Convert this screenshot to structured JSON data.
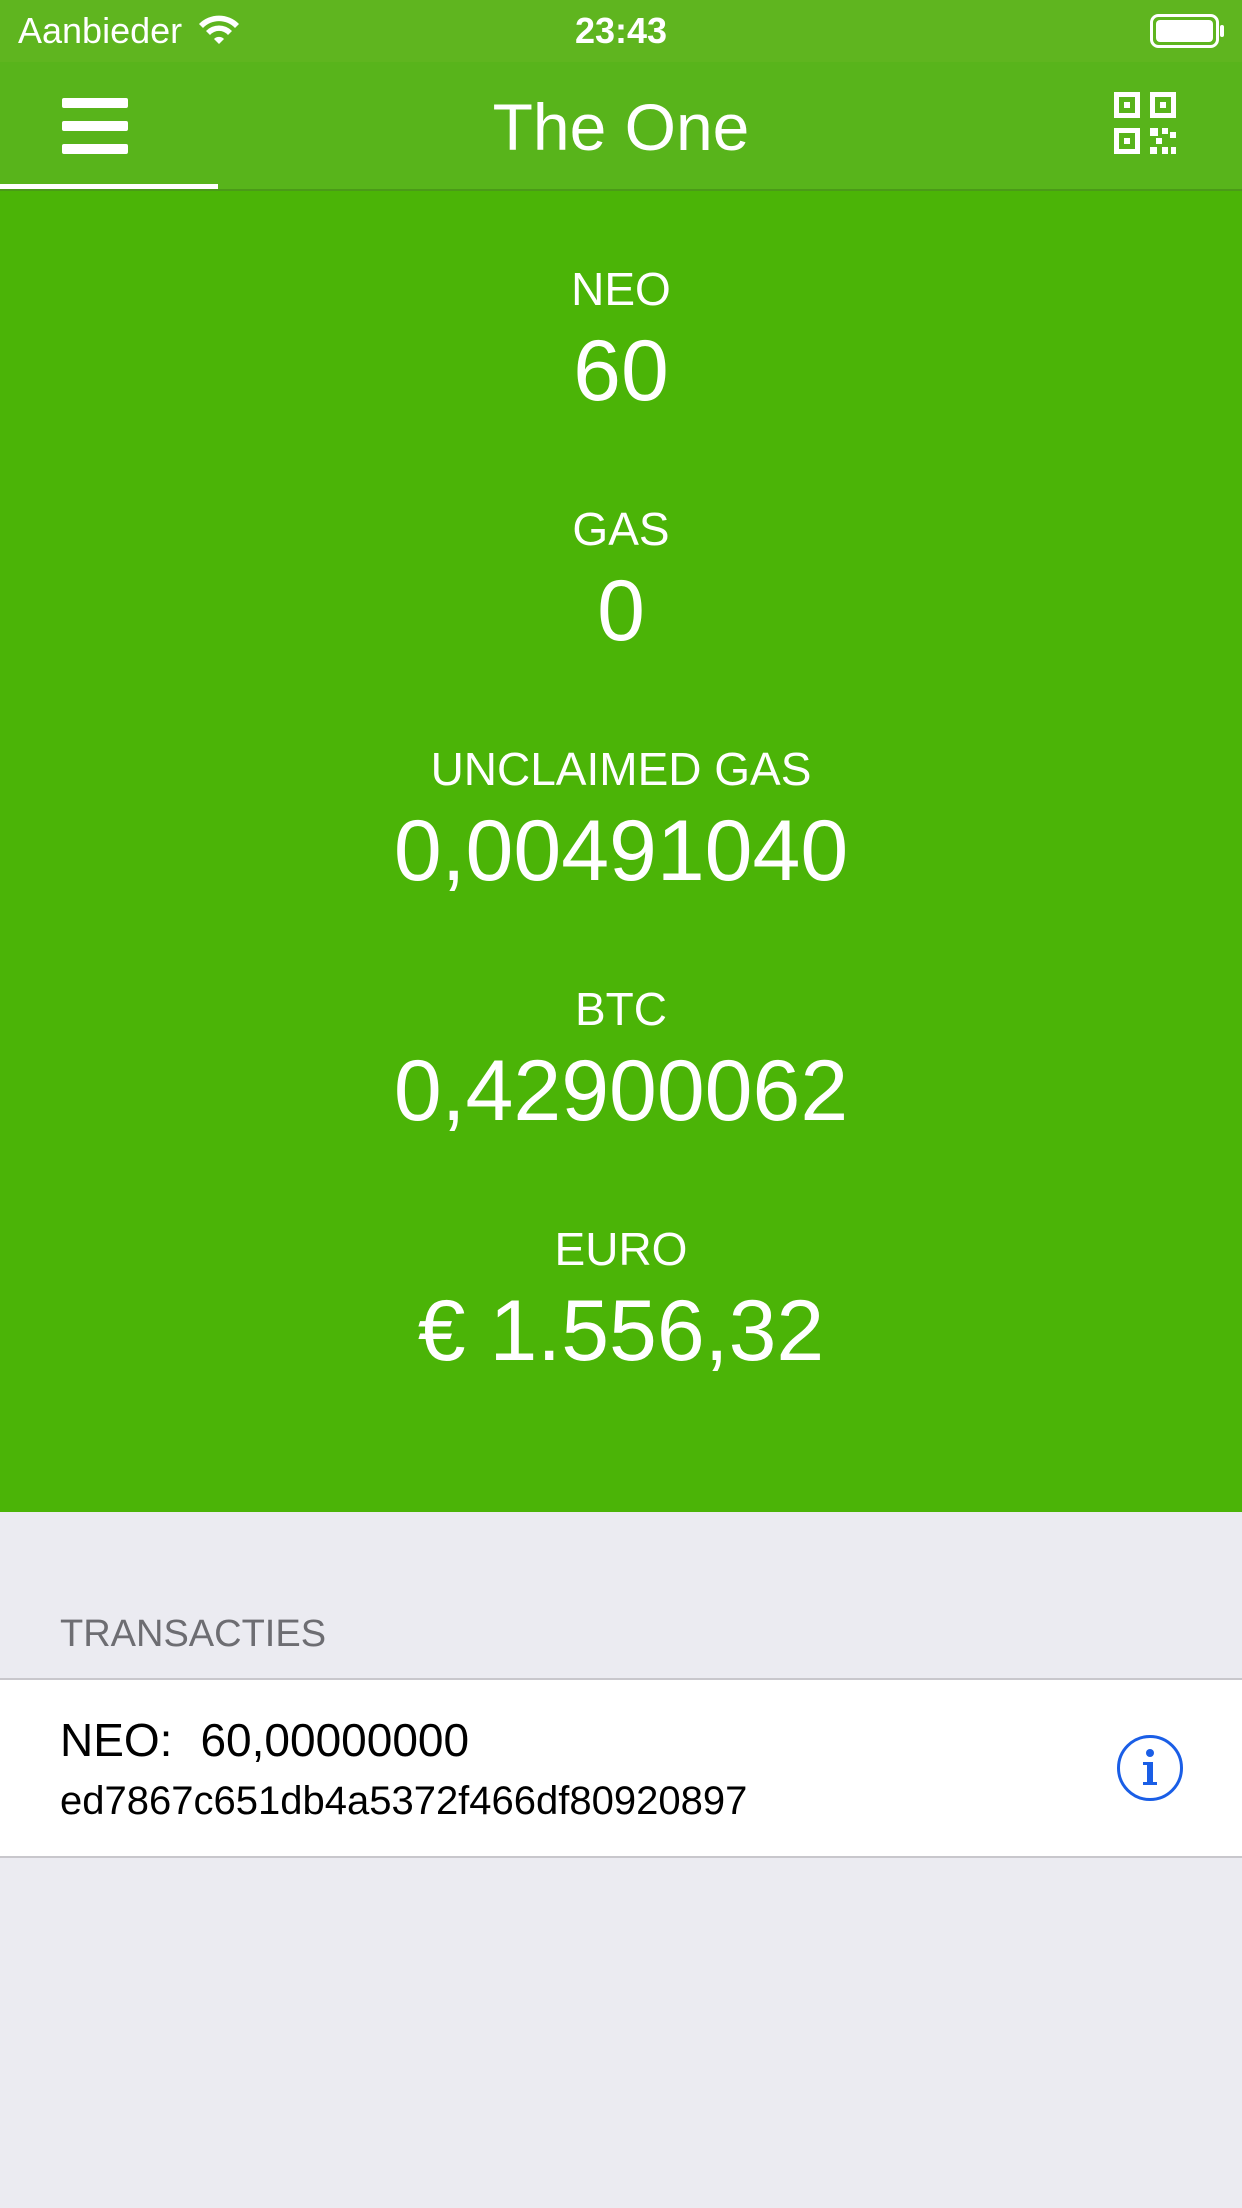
{
  "status_bar": {
    "carrier": "Aanbieder",
    "time": "23:43"
  },
  "nav": {
    "title": "The One"
  },
  "balances": [
    {
      "label": "NEO",
      "value": "60"
    },
    {
      "label": "GAS",
      "value": "0"
    },
    {
      "label": "UNCLAIMED GAS",
      "value": "0,00491040"
    },
    {
      "label": "BTC",
      "value": "0,42900062"
    },
    {
      "label": "EURO",
      "value": "€ 1.556,32"
    }
  ],
  "transactions": {
    "header": "TRANSACTIES",
    "items": [
      {
        "asset": "NEO:",
        "amount": "60,00000000",
        "hash": "ed7867c651db4a5372f466df80920897"
      }
    ]
  },
  "colors": {
    "status_bar": "#5fb51f",
    "nav_bar": "#58b41b",
    "balance_bg": "#4bb407",
    "page_bg": "#ebebf1",
    "info_blue": "#1a5ee6"
  },
  "icons": {
    "menu": "hamburger-icon",
    "qr": "qr-code-icon",
    "info": "info-icon",
    "wifi": "wifi-icon",
    "battery": "battery-icon"
  }
}
